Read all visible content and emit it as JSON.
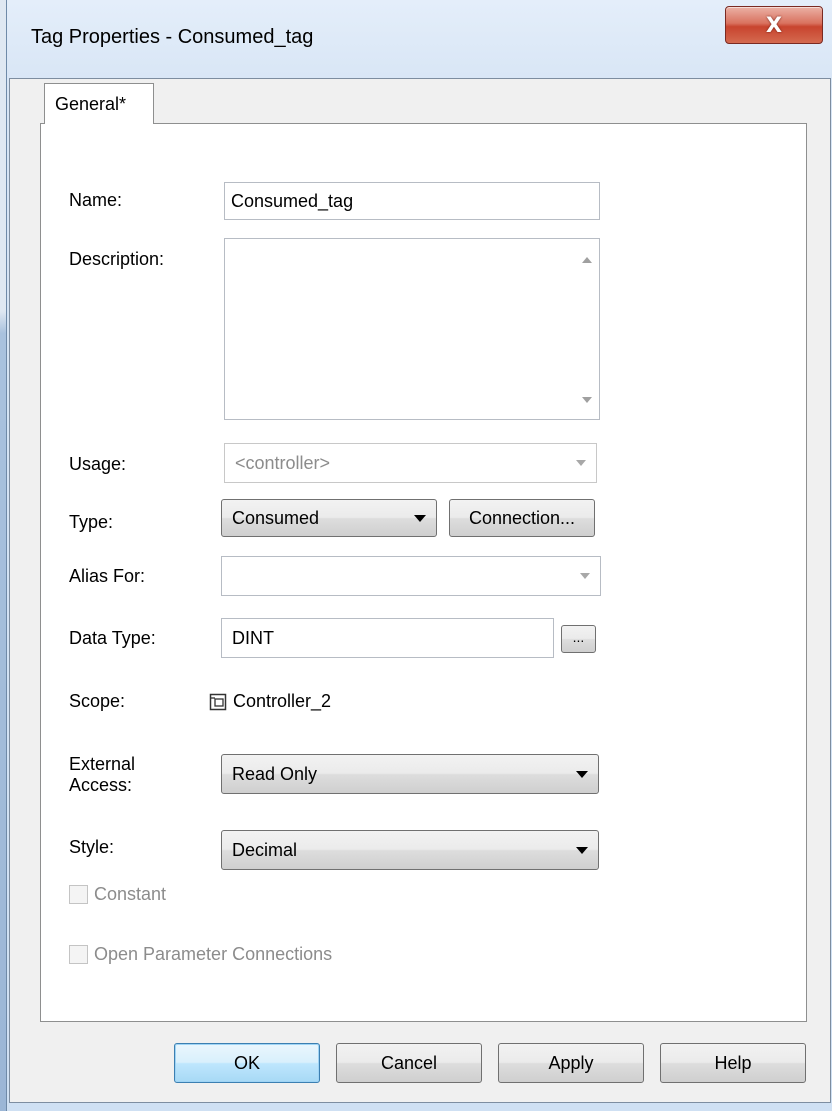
{
  "window": {
    "title": "Tag Properties - Consumed_tag",
    "close_label": "X"
  },
  "tabs": [
    {
      "label": "General*"
    }
  ],
  "form": {
    "name_label": "Name:",
    "name_value": "Consumed_tag",
    "description_label": "Description:",
    "description_value": "",
    "usage_label": "Usage:",
    "usage_value": "<controller>",
    "type_label": "Type:",
    "type_value": "Consumed",
    "connection_button": "Connection...",
    "alias_label": "Alias For:",
    "alias_value": "",
    "data_type_label": "Data Type:",
    "data_type_value": "DINT",
    "data_type_browse": "...",
    "scope_label": "Scope:",
    "scope_value": "Controller_2",
    "external_access_label_line1": "External",
    "external_access_label_line2": "Access:",
    "external_access_value": "Read Only",
    "style_label": "Style:",
    "style_value": "Decimal",
    "constant_label": "Constant",
    "constant_checked": false,
    "open_param_label": "Open Parameter Connections",
    "open_param_checked": false
  },
  "buttons": {
    "ok": "OK",
    "cancel": "Cancel",
    "apply": "Apply",
    "help": "Help"
  }
}
